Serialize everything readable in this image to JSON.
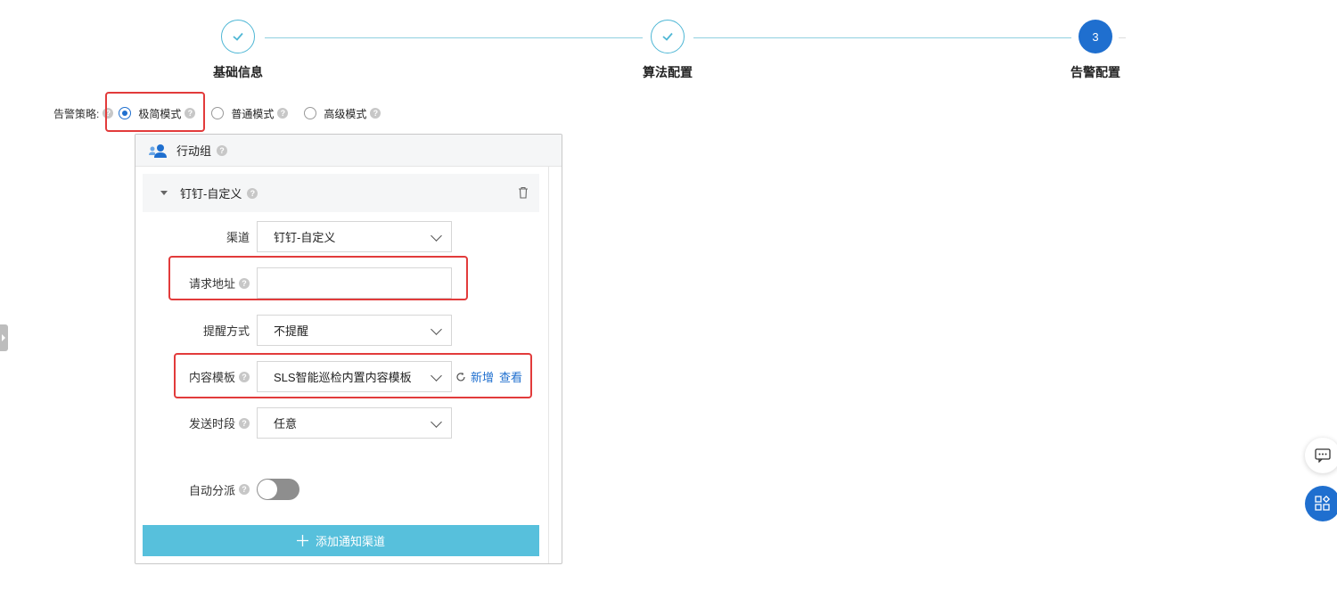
{
  "steps": [
    {
      "label": "基础信息",
      "state": "done"
    },
    {
      "label": "算法配置",
      "state": "done"
    },
    {
      "label": "告警配置",
      "state": "active",
      "number": "3"
    }
  ],
  "strategy": {
    "label": "告警策略:",
    "options": [
      {
        "label": "极简模式",
        "checked": true
      },
      {
        "label": "普通模式",
        "checked": false
      },
      {
        "label": "高级模式",
        "checked": false
      }
    ]
  },
  "action_group": {
    "title": "行动组",
    "channel": {
      "title": "钉钉-自定义",
      "fields": {
        "channel_label": "渠道",
        "channel_value": "钉钉-自定义",
        "url_label": "请求地址",
        "url_value": "",
        "remind_label": "提醒方式",
        "remind_value": "不提醒",
        "template_label": "内容模板",
        "template_value": "SLS智能巡检内置内容模板",
        "template_new": "新增",
        "template_view": "查看",
        "period_label": "发送时段",
        "period_value": "任意",
        "auto_dispatch_label": "自动分派",
        "auto_dispatch_on": false
      }
    },
    "add_channel_label": "添加通知渠道"
  },
  "colors": {
    "accent": "#1f6fcf",
    "step_line": "#8fd0e0",
    "add_bar": "#57c0dc",
    "highlight": "#e23b3b"
  }
}
